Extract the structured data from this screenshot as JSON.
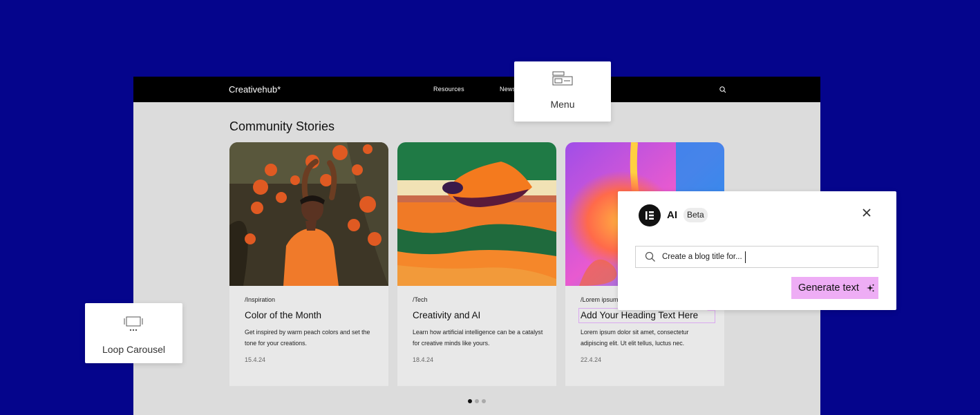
{
  "site": {
    "logo": "Creativehub*",
    "nav": [
      "Resources",
      "News"
    ],
    "section_title": "Community Stories"
  },
  "cards": [
    {
      "category": "/Inspiration",
      "title": "Color of the Month",
      "description": "Get inspired by warm peach colors and set the tone for your creations.",
      "date": "15.4.24"
    },
    {
      "category": "/Tech",
      "title": "Creativity and AI",
      "description": "Learn how artificial intelligence can be a catalyst for creative minds like yours.",
      "date": "18.4.24"
    },
    {
      "category": "/Lorem ipsum",
      "title": "Add Your Heading Text Here",
      "description": "Lorem ipsum dolor sit amet, consectetur adipiscing elit. Ut elit tellus, luctus nec.",
      "date": "22.4.24"
    }
  ],
  "carousel": {
    "slides": 3,
    "active_slide": 1
  },
  "widgets": {
    "menu": {
      "label": "Menu",
      "icon": "menu-widget-icon"
    },
    "loop_carousel": {
      "label": "Loop Carousel",
      "icon": "loop-carousel-icon"
    }
  },
  "ai": {
    "title": "AI",
    "badge": "Beta",
    "prompt_value": "Create a blog title for...",
    "generate_label": "Generate text",
    "accent": "#eeadf5"
  },
  "colors": {
    "background": "#05058c",
    "header": "#000000",
    "page": "#dcdcdc"
  }
}
